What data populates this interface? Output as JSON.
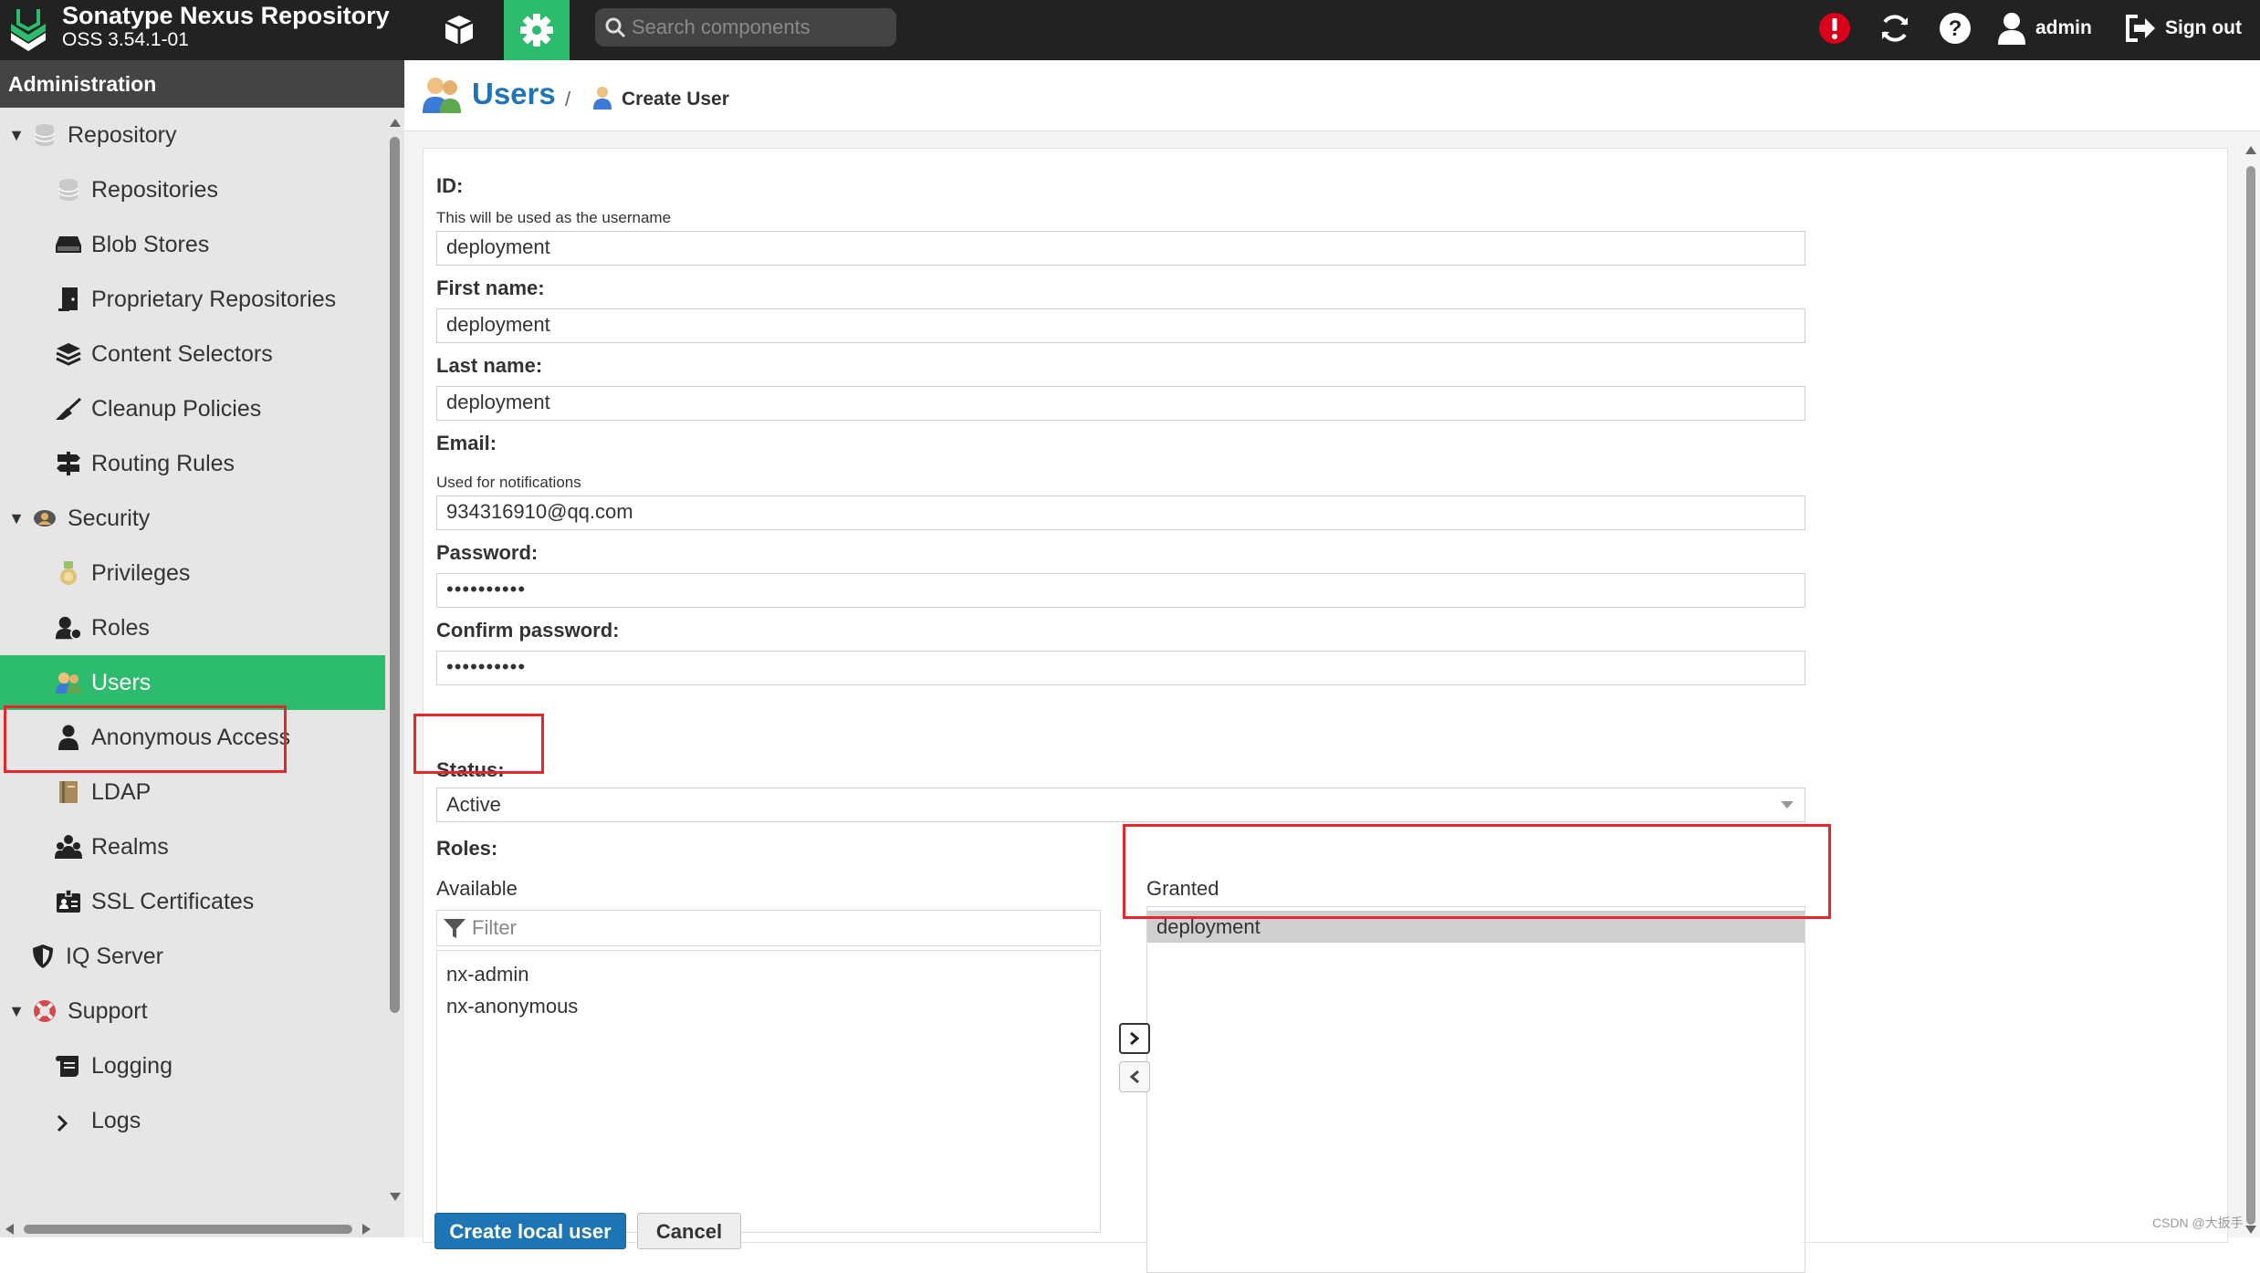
{
  "app": {
    "title": "Sonatype Nexus Repository",
    "version": "OSS 3.54.1-01"
  },
  "topbar": {
    "search_placeholder": "Search components",
    "user_name": "admin",
    "signout_label": "Sign out",
    "icons": [
      "browse-cube-icon",
      "gear-icon",
      "search-icon",
      "alert-icon",
      "refresh-icon",
      "help-icon",
      "user-icon",
      "sign-out-icon"
    ]
  },
  "sidebar": {
    "header": "Administration",
    "items": [
      {
        "label": "Repository",
        "icon": "database-icon",
        "level": 0,
        "expanded": true
      },
      {
        "label": "Repositories",
        "icon": "database-icon",
        "level": 1
      },
      {
        "label": "Blob Stores",
        "icon": "hard-drive-icon",
        "level": 1
      },
      {
        "label": "Proprietary Repositories",
        "icon": "door-icon",
        "level": 1
      },
      {
        "label": "Content Selectors",
        "icon": "layers-icon",
        "level": 1
      },
      {
        "label": "Cleanup Policies",
        "icon": "broom-icon",
        "level": 1
      },
      {
        "label": "Routing Rules",
        "icon": "signpost-icon",
        "level": 1
      },
      {
        "label": "Security",
        "icon": "security-icon",
        "level": 0,
        "expanded": true
      },
      {
        "label": "Privileges",
        "icon": "medal-icon",
        "level": 1
      },
      {
        "label": "Roles",
        "icon": "roles-icon",
        "level": 1
      },
      {
        "label": "Users",
        "icon": "users-icon",
        "level": 1,
        "selected": true
      },
      {
        "label": "Anonymous Access",
        "icon": "person-icon",
        "level": 1
      },
      {
        "label": "LDAP",
        "icon": "book-icon",
        "level": 1
      },
      {
        "label": "Realms",
        "icon": "realms-icon",
        "level": 1
      },
      {
        "label": "SSL Certificates",
        "icon": "certificate-icon",
        "level": 1
      },
      {
        "label": "IQ Server",
        "icon": "shield-icon",
        "level": 0
      },
      {
        "label": "Support",
        "icon": "lifebuoy-icon",
        "level": 0,
        "expanded": true
      },
      {
        "label": "Logging",
        "icon": "scroll-icon",
        "level": 1
      },
      {
        "label": "Logs",
        "icon": "logs-icon",
        "level": 1
      }
    ]
  },
  "breadcrumb": {
    "section": "Users",
    "separator": "/",
    "page": "Create User"
  },
  "form": {
    "id_label": "ID:",
    "id_help": "This will be used as the username",
    "id_value": "deployment",
    "first_name_label": "First name:",
    "first_name_value": "deployment",
    "last_name_label": "Last name:",
    "last_name_value": "deployment",
    "email_label": "Email:",
    "email_help": "Used for notifications",
    "email_value": "934316910@qq.com",
    "password_label": "Password:",
    "password_value": "••••••••••",
    "confirm_label": "Confirm password:",
    "confirm_value": "••••••••••",
    "status_label": "Status:",
    "status_value": "Active",
    "roles_label": "Roles:",
    "available_title": "Available",
    "filter_placeholder": "Filter",
    "available_roles": [
      "nx-admin",
      "nx-anonymous"
    ],
    "granted_title": "Granted",
    "granted_roles": [
      "deployment"
    ],
    "create_button": "Create local user",
    "cancel_button": "Cancel"
  },
  "colors": {
    "accent": "#2dbc6e",
    "primary": "#1e75b5",
    "topbar": "#222222",
    "highlight": "#e8262a"
  },
  "watermark": "CSDN @大扳手"
}
